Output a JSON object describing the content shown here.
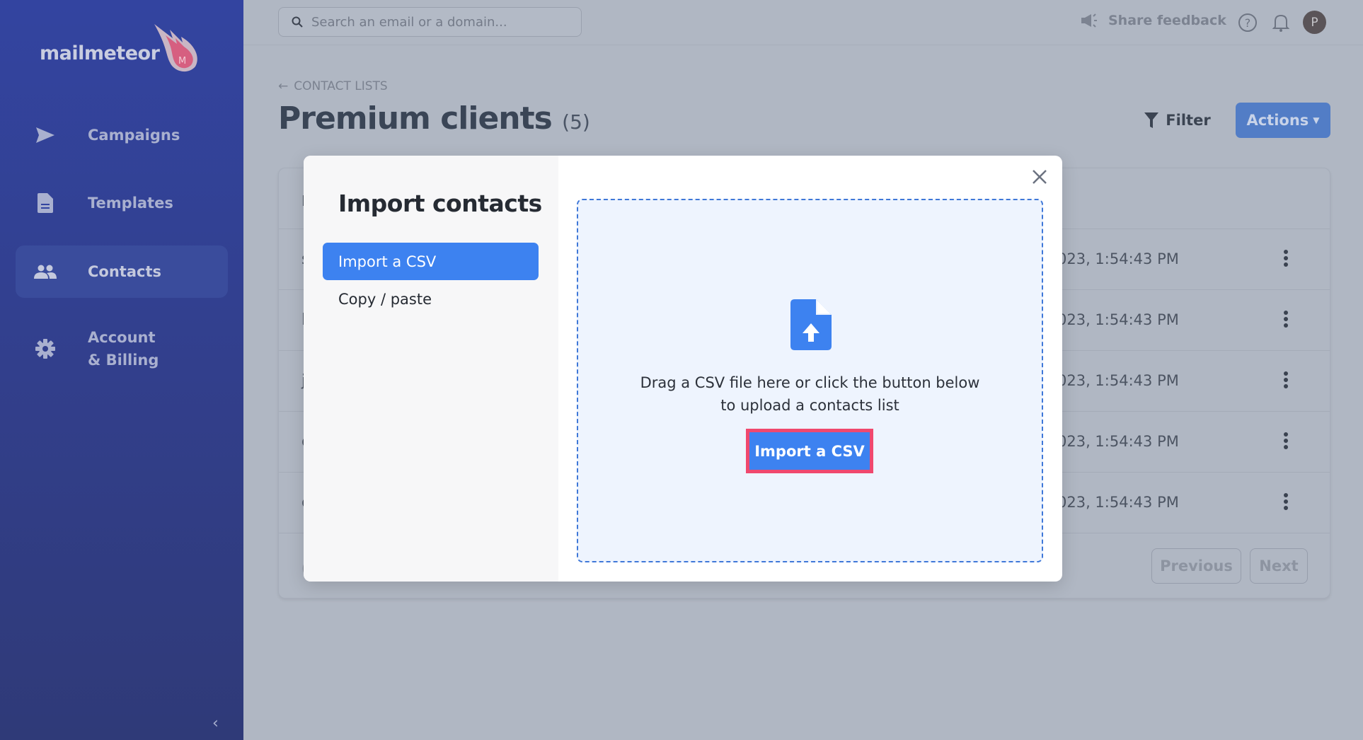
{
  "brand": {
    "name": "mailmeteor",
    "logo_letter": "M"
  },
  "sidebar": {
    "items": [
      {
        "label": "Campaigns",
        "icon": "send-icon"
      },
      {
        "label": "Templates",
        "icon": "document-icon"
      },
      {
        "label": "Contacts",
        "icon": "users-icon",
        "active": true
      },
      {
        "label": "Account",
        "label2": "& Billing",
        "icon": "gear-icon"
      }
    ]
  },
  "topbar": {
    "search_placeholder": "Search an email or a domain...",
    "feedback": "Share feedback",
    "avatar": "P"
  },
  "page": {
    "breadcrumb": "CONTACT LISTS",
    "title": "Premium clients",
    "count": "(5)",
    "filter": "Filter",
    "actions": "Actions"
  },
  "table": {
    "header_first": "I",
    "rows": [
      {
        "first": "s",
        "date": "023, 1:54:43 PM"
      },
      {
        "first": "l",
        "date": "023, 1:54:43 PM"
      },
      {
        "first": "j",
        "date": "023, 1:54:43 PM"
      },
      {
        "first": "c",
        "date": "023, 1:54:43 PM"
      },
      {
        "first": "c",
        "date": "023, 1:54:43 PM"
      }
    ],
    "footer_first": "(",
    "previous": "Previous",
    "next": "Next"
  },
  "modal": {
    "title": "Import contacts",
    "tabs": [
      {
        "label": "Import a CSV",
        "active": true
      },
      {
        "label": "Copy / paste"
      }
    ],
    "drop_line1": "Drag a CSV file here or click the button below",
    "drop_line2": "to upload a contacts list",
    "button": "Import a CSV"
  },
  "colors": {
    "primary": "#3d82f0",
    "highlight": "#f0486e",
    "sidebar": "#3344a0"
  }
}
